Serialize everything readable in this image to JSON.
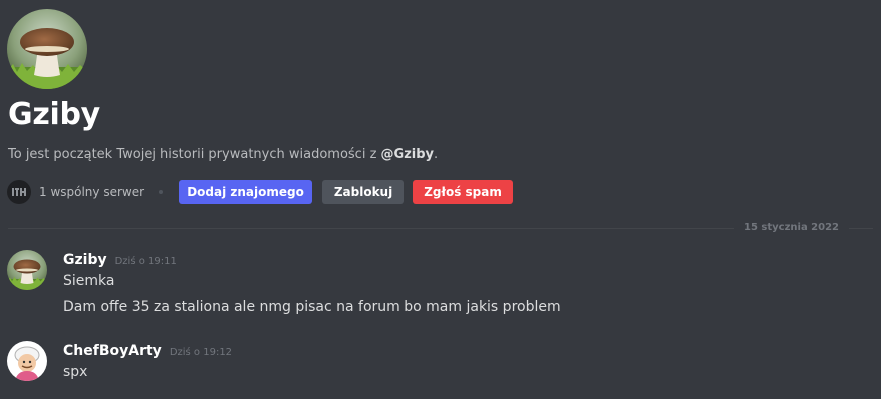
{
  "profile": {
    "avatar_icon": "mushroom-avatar",
    "username": "Gziby",
    "intro_prefix": "To jest początek Twojej historii prywatnych wiadomości z ",
    "intro_mention": "@Gziby",
    "intro_suffix": ".",
    "mutual_servers": "1 wspólny serwer",
    "server_icon": "server-icon"
  },
  "actions": {
    "add_friend": "Dodaj znajomego",
    "block": "Zablokuj",
    "report_spam": "Zgłoś spam"
  },
  "divider": {
    "date": "15 stycznia 2022"
  },
  "messages": [
    {
      "author": "Gziby",
      "timestamp": "Dziś o 19:11",
      "avatar_icon": "mushroom-avatar",
      "lines": [
        "Siemka",
        "Dam offe 35 za staliona ale nmg pisac na forum bo mam jakis problem"
      ]
    },
    {
      "author": "ChefBoyArty",
      "timestamp": "Dziś o 19:12",
      "avatar_icon": "chef-avatar",
      "lines": [
        "spx"
      ]
    }
  ],
  "colors": {
    "background": "#36393f",
    "blurple": "#5865f2",
    "grey_button": "#4f545c",
    "red": "#ed4245"
  }
}
